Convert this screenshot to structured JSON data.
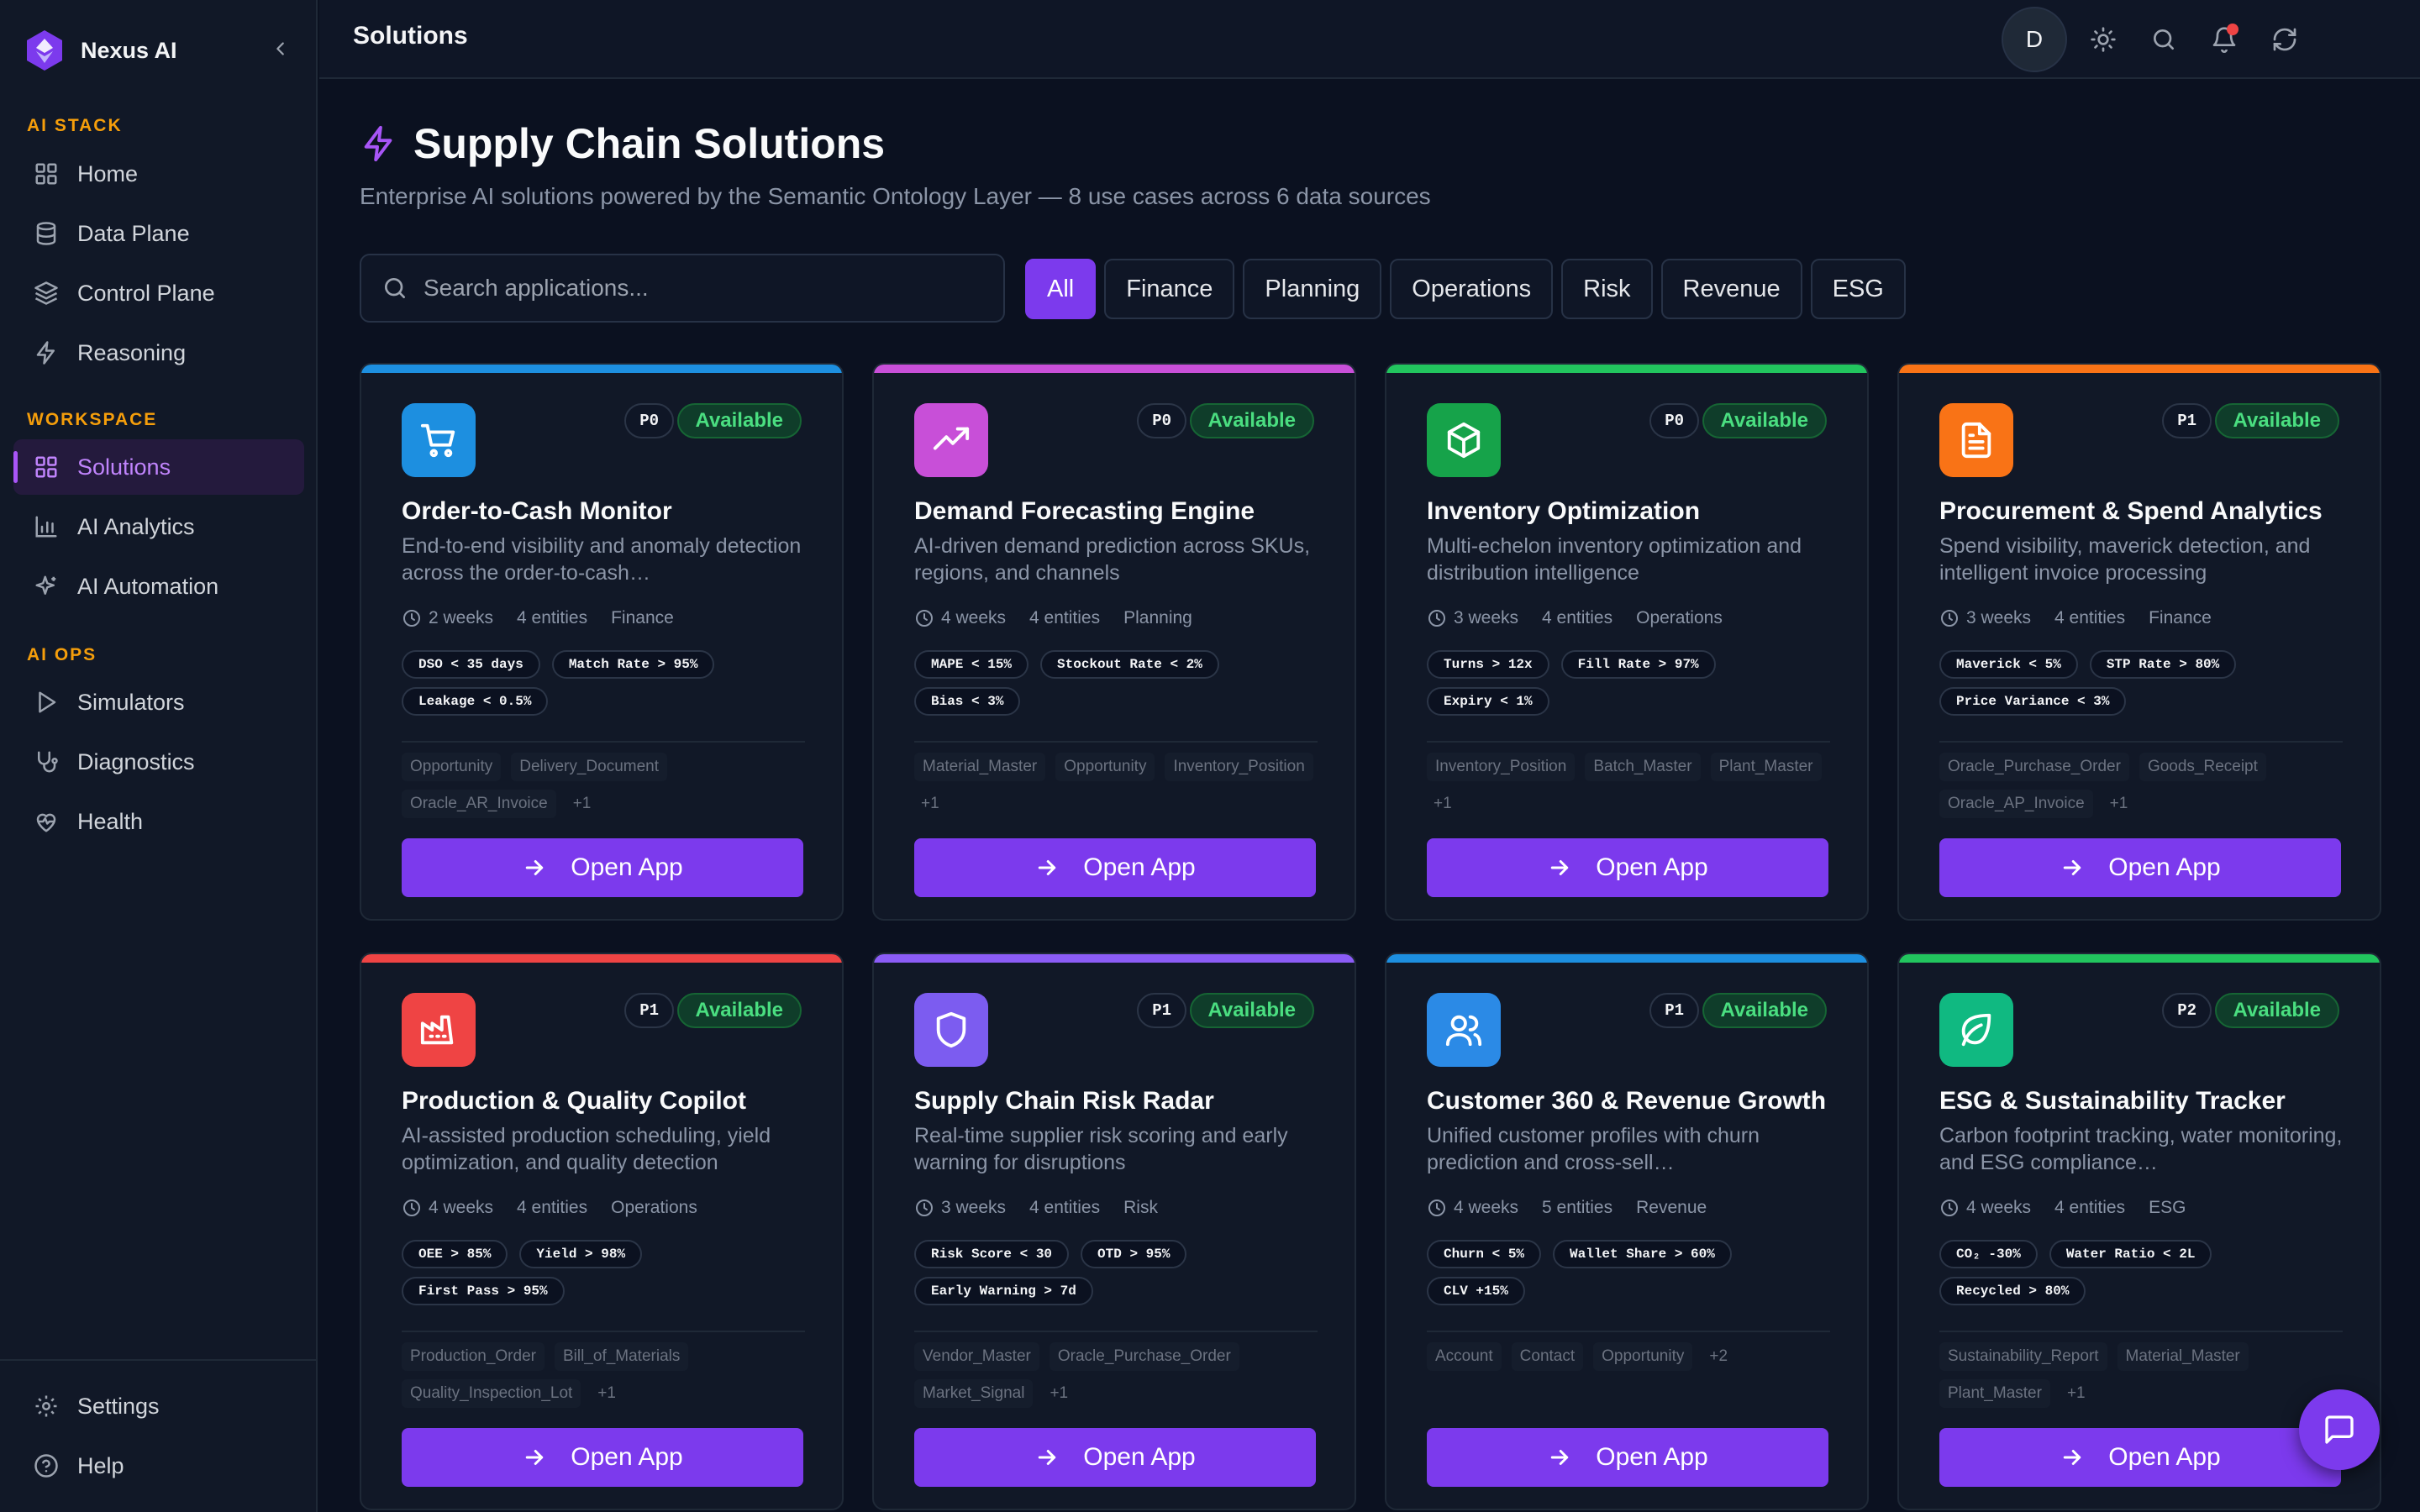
{
  "brand": {
    "name": "Nexus AI"
  },
  "sidebar": {
    "sections": [
      {
        "label": "AI STACK",
        "items": [
          {
            "label": "Home",
            "icon": "grid-icon"
          },
          {
            "label": "Data Plane",
            "icon": "database-icon"
          },
          {
            "label": "Control Plane",
            "icon": "layers-icon"
          },
          {
            "label": "Reasoning",
            "icon": "bolt-icon"
          }
        ]
      },
      {
        "label": "WORKSPACE",
        "items": [
          {
            "label": "Solutions",
            "icon": "grid-icon",
            "active": true
          },
          {
            "label": "AI Analytics",
            "icon": "bar-chart-icon"
          },
          {
            "label": "AI Automation",
            "icon": "sparkles-icon"
          }
        ]
      },
      {
        "label": "AI OPS",
        "items": [
          {
            "label": "Simulators",
            "icon": "play-icon"
          },
          {
            "label": "Diagnostics",
            "icon": "stethoscope-icon"
          },
          {
            "label": "Health",
            "icon": "heart-pulse-icon"
          }
        ]
      }
    ],
    "footer": [
      {
        "label": "Settings",
        "icon": "gear-icon"
      },
      {
        "label": "Help",
        "icon": "help-circle-icon"
      }
    ]
  },
  "header": {
    "title": "Solutions",
    "avatar_initial": "D"
  },
  "page": {
    "title": "Supply Chain Solutions",
    "subtitle": "Enterprise AI solutions powered by the Semantic Ontology Layer — 8 use cases across 6 data sources",
    "search_placeholder": "Search applications...",
    "filters": [
      "All",
      "Finance",
      "Planning",
      "Operations",
      "Risk",
      "Revenue",
      "ESG"
    ],
    "active_filter": "All"
  },
  "open_app_label": "Open App",
  "cards": [
    {
      "title": "Order-to-Cash Monitor",
      "priority": "P0",
      "status": "Available",
      "description": "End-to-end visibility and anomaly detection across the order-to-cash…",
      "duration": "2 weeks",
      "entities_count": "4 entities",
      "category": "Finance",
      "kpis": [
        "DSO < 35 days",
        "Match Rate > 95%",
        "Leakage < 0.5%"
      ],
      "entities": [
        "Opportunity",
        "Delivery_Document",
        "Oracle_AR_Invoice"
      ],
      "more": "+1",
      "accent": "#1d8fe0",
      "icon_bg": "#1d8fe0",
      "icon": "cart-icon"
    },
    {
      "title": "Demand Forecasting Engine",
      "priority": "P0",
      "status": "Available",
      "description": "AI-driven demand prediction across SKUs, regions, and channels",
      "duration": "4 weeks",
      "entities_count": "4 entities",
      "category": "Planning",
      "kpis": [
        "MAPE < 15%",
        "Stockout Rate < 2%",
        "Bias < 3%"
      ],
      "entities": [
        "Material_Master",
        "Opportunity",
        "Inventory_Position"
      ],
      "more": "+1",
      "accent": "#c84fd8",
      "icon_bg": "#c84fd8",
      "icon": "trending-up-icon"
    },
    {
      "title": "Inventory Optimization",
      "priority": "P0",
      "status": "Available",
      "description": "Multi-echelon inventory optimization and distribution intelligence",
      "duration": "3 weeks",
      "entities_count": "4 entities",
      "category": "Operations",
      "kpis": [
        "Turns > 12x",
        "Fill Rate > 97%",
        "Expiry < 1%"
      ],
      "entities": [
        "Inventory_Position",
        "Batch_Master",
        "Plant_Master"
      ],
      "more": "+1",
      "accent": "#22c55e",
      "icon_bg": "#16a34a",
      "icon": "box-icon"
    },
    {
      "title": "Procurement & Spend Analytics",
      "priority": "P1",
      "status": "Available",
      "description": "Spend visibility, maverick detection, and intelligent invoice processing",
      "duration": "3 weeks",
      "entities_count": "4 entities",
      "category": "Finance",
      "kpis": [
        "Maverick < 5%",
        "STP Rate > 80%",
        "Price Variance < 3%"
      ],
      "entities": [
        "Oracle_Purchase_Order",
        "Goods_Receipt",
        "Oracle_AP_Invoice"
      ],
      "more": "+1",
      "accent": "#f97316",
      "icon_bg": "#f97316",
      "icon": "document-icon"
    },
    {
      "title": "Production & Quality Copilot",
      "priority": "P1",
      "status": "Available",
      "description": "AI-assisted production scheduling, yield optimization, and quality detection",
      "duration": "4 weeks",
      "entities_count": "4 entities",
      "category": "Operations",
      "kpis": [
        "OEE > 85%",
        "Yield > 98%",
        "First Pass > 95%"
      ],
      "entities": [
        "Production_Order",
        "Bill_of_Materials",
        "Quality_Inspection_Lot"
      ],
      "more": "+1",
      "accent": "#ef4444",
      "icon_bg": "#ef4444",
      "icon": "factory-icon"
    },
    {
      "title": "Supply Chain Risk Radar",
      "priority": "P1",
      "status": "Available",
      "description": "Real-time supplier risk scoring and early warning for disruptions",
      "duration": "3 weeks",
      "entities_count": "4 entities",
      "category": "Risk",
      "kpis": [
        "Risk Score < 30",
        "OTD > 95%",
        "Early Warning > 7d"
      ],
      "entities": [
        "Vendor_Master",
        "Oracle_Purchase_Order",
        "Market_Signal"
      ],
      "more": "+1",
      "accent": "#8b5cf6",
      "icon_bg": "#7c5cf0",
      "icon": "shield-icon"
    },
    {
      "title": "Customer 360 & Revenue Growth",
      "priority": "P1",
      "status": "Available",
      "description": "Unified customer profiles with churn prediction and cross-sell…",
      "duration": "4 weeks",
      "entities_count": "5 entities",
      "category": "Revenue",
      "kpis": [
        "Churn < 5%",
        "Wallet Share > 60%",
        "CLV +15%"
      ],
      "entities": [
        "Account",
        "Contact",
        "Opportunity"
      ],
      "more": "+2",
      "accent": "#1d8fe0",
      "icon_bg": "#2b8ae6",
      "icon": "users-icon"
    },
    {
      "title": "ESG & Sustainability Tracker",
      "priority": "P2",
      "status": "Available",
      "description": "Carbon footprint tracking, water monitoring, and ESG compliance…",
      "duration": "4 weeks",
      "entities_count": "4 entities",
      "category": "ESG",
      "kpis": [
        "CO₂ -30%",
        "Water Ratio < 2L",
        "Recycled > 80%"
      ],
      "entities": [
        "Sustainability_Report",
        "Material_Master",
        "Plant_Master"
      ],
      "more": "+1",
      "accent": "#22c55e",
      "icon_bg": "#10b981",
      "icon": "leaf-icon"
    }
  ]
}
